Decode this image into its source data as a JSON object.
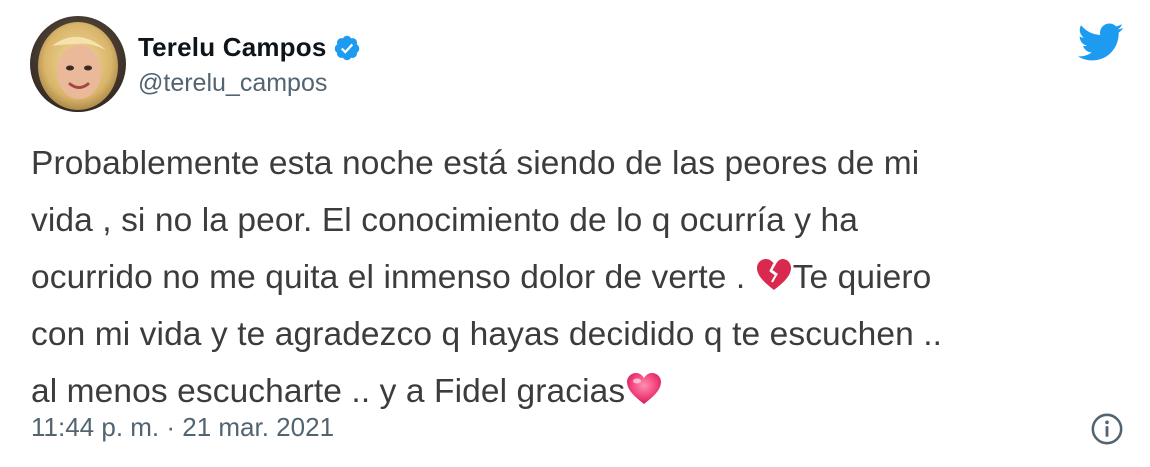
{
  "author": {
    "display_name": "Terelu Campos",
    "handle": "@terelu_campos",
    "verified": true,
    "avatar_icon": "avatar-photo"
  },
  "brand": {
    "logo_icon": "twitter-bird-icon",
    "accent_color": "#1d9bf0"
  },
  "tweet": {
    "lines": [
      "Probablemente esta noche está siendo de las peores de mi",
      "vida , si no la peor. El conocimiento de lo q ocurría y ha",
      "ocurrido no me quita el inmenso dolor de verte . ",
      "Te quiero",
      "con mi vida y te agradezco q hayas decidido q te escuchen ..",
      "al menos escucharte .. y a Fidel gracias"
    ],
    "emojis": [
      "broken-heart-emoji",
      "sparkling-heart-emoji"
    ]
  },
  "footer": {
    "timestamp": "11:44 p. m. · 21 mar. 2021",
    "info_icon": "info-icon"
  }
}
